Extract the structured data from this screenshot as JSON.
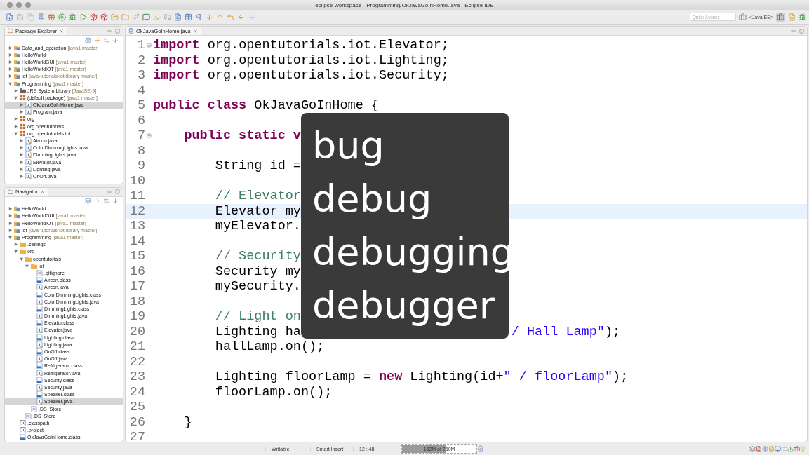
{
  "window": {
    "title": "eclipse-workspace - Programming/OkJavaGoInHome.java - Eclipse IDE"
  },
  "toolbar": {
    "quick_access": {
      "placeholder": "Quick Access"
    },
    "perspective": "<Java EE>"
  },
  "package_explorer": {
    "tab": "Package Explorer",
    "items": [
      {
        "kind": "project",
        "label": "Data_and_operation",
        "decoration": "[java1 master]",
        "expanded": false,
        "selected": false
      },
      {
        "kind": "project",
        "label": "HelloWorld",
        "expanded": false,
        "selected": false
      },
      {
        "kind": "project",
        "label": "HelloWorldGUI",
        "decoration": "[java1 master]",
        "expanded": false,
        "selected": false
      },
      {
        "kind": "project",
        "label": "HelloWorldIOT",
        "decoration": "[java1 master]",
        "expanded": false,
        "selected": false
      },
      {
        "kind": "project",
        "label": "iot",
        "decoration": "[java-tutorials-iot-library master]",
        "expanded": false,
        "selected": false
      },
      {
        "kind": "project",
        "label": "Programming",
        "decoration": "[java1 master]",
        "expanded": true,
        "selected": false,
        "children": [
          {
            "kind": "library",
            "label": "JRE System Library",
            "decoration": "[JavaSE-9]",
            "expanded": false,
            "selected": false
          },
          {
            "kind": "package",
            "label": "(default package)",
            "decoration": "[java1 master]",
            "expanded": true,
            "selected": false,
            "children": [
              {
                "kind": "java",
                "label": "OkJavaGoInHome.java",
                "expanded": false,
                "selected": true
              },
              {
                "kind": "java",
                "label": "Program.java",
                "expanded": false,
                "selected": false
              }
            ]
          },
          {
            "kind": "package",
            "label": "org",
            "expanded": false,
            "selected": false
          },
          {
            "kind": "package",
            "label": "org.opentutorials",
            "expanded": false,
            "selected": false
          },
          {
            "kind": "package",
            "label": "org.opentutorials.iot",
            "expanded": true,
            "selected": false,
            "children": [
              {
                "kind": "java",
                "label": "Aircon.java",
                "expanded": false,
                "selected": false
              },
              {
                "kind": "java",
                "label": "ColorDimmingLights.java",
                "expanded": false,
                "selected": false
              },
              {
                "kind": "java",
                "label": "DimmingLights.java",
                "expanded": false,
                "selected": false
              },
              {
                "kind": "java",
                "label": "Elevator.java",
                "expanded": false,
                "selected": false
              },
              {
                "kind": "java",
                "label": "Lighting.java",
                "expanded": false,
                "selected": false
              },
              {
                "kind": "java",
                "label": "OnOff.java",
                "expanded": false,
                "selected": false
              }
            ]
          }
        ]
      }
    ]
  },
  "navigator": {
    "tab": "Navigator",
    "items": [
      {
        "kind": "project",
        "label": "HelloWorld",
        "expanded": false,
        "selected": false
      },
      {
        "kind": "project",
        "label": "HelloWorldGUI",
        "decoration": "[java1 master]",
        "expanded": false,
        "selected": false
      },
      {
        "kind": "project",
        "label": "HelloWorldIOT",
        "decoration": "[java1 master]",
        "expanded": false,
        "selected": false
      },
      {
        "kind": "project",
        "label": "iot",
        "decoration": "[java-tutorials-iot-library master]",
        "expanded": false,
        "selected": false
      },
      {
        "kind": "project",
        "label": "Programming",
        "decoration": "[java1 master]",
        "expanded": true,
        "selected": false,
        "children": [
          {
            "kind": "folder",
            "label": ".settings",
            "expanded": false,
            "selected": false
          },
          {
            "kind": "folder",
            "label": "org",
            "expanded": true,
            "selected": false,
            "children": [
              {
                "kind": "folder",
                "label": "opentutorials",
                "expanded": true,
                "selected": false,
                "children": [
                  {
                    "kind": "folder",
                    "label": "iot",
                    "expanded": true,
                    "selected": false,
                    "children": [
                      {
                        "kind": "file",
                        "label": ".gitignore",
                        "selected": false
                      },
                      {
                        "kind": "class",
                        "label": "Aircon.class",
                        "selected": false
                      },
                      {
                        "kind": "java",
                        "label": "Aircon.java",
                        "selected": false
                      },
                      {
                        "kind": "class",
                        "label": "ColorDimmingLights.class",
                        "selected": false
                      },
                      {
                        "kind": "java",
                        "label": "ColorDimmingLights.java",
                        "selected": false
                      },
                      {
                        "kind": "class",
                        "label": "DimmingLights.class",
                        "selected": false
                      },
                      {
                        "kind": "java",
                        "label": "DimmingLights.java",
                        "selected": false
                      },
                      {
                        "kind": "class",
                        "label": "Elevator.class",
                        "selected": false
                      },
                      {
                        "kind": "java",
                        "label": "Elevator.java",
                        "selected": false
                      },
                      {
                        "kind": "class",
                        "label": "Lighting.class",
                        "selected": false
                      },
                      {
                        "kind": "java",
                        "label": "Lighting.java",
                        "selected": false
                      },
                      {
                        "kind": "class",
                        "label": "OnOff.class",
                        "selected": false
                      },
                      {
                        "kind": "java",
                        "label": "OnOff.java",
                        "selected": false
                      },
                      {
                        "kind": "class",
                        "label": "Refrigerator.class",
                        "selected": false
                      },
                      {
                        "kind": "java",
                        "label": "Refrigerator.java",
                        "selected": false
                      },
                      {
                        "kind": "class",
                        "label": "Security.class",
                        "selected": false
                      },
                      {
                        "kind": "java",
                        "label": "Security.java",
                        "selected": false
                      },
                      {
                        "kind": "class",
                        "label": "Speaker.class",
                        "selected": false
                      },
                      {
                        "kind": "java",
                        "label": "Speaker.java",
                        "selected": true
                      }
                    ]
                  },
                  {
                    "kind": "file",
                    "label": ".DS_Store",
                    "selected": false
                  }
                ]
              },
              {
                "kind": "file",
                "label": ".DS_Store",
                "selected": false
              }
            ]
          },
          {
            "kind": "xml",
            "label": ".classpath",
            "selected": false
          },
          {
            "kind": "xml",
            "label": ".project",
            "selected": false
          },
          {
            "kind": "class",
            "label": "OkJavaGoInHome.class",
            "selected": false
          }
        ]
      }
    ]
  },
  "editor": {
    "tab": "OkJavaGoInHome.java",
    "lines": [
      {
        "number": "1",
        "fold": true,
        "current": false,
        "code": [
          {
            "kind": "keyword",
            "text": "import"
          },
          {
            "kind": "plain",
            "text": " org.opentutorials.iot.Elevator;"
          }
        ]
      },
      {
        "number": "2",
        "fold": false,
        "current": false,
        "code": [
          {
            "kind": "keyword",
            "text": "import"
          },
          {
            "kind": "plain",
            "text": " org.opentutorials.iot.Lighting;"
          }
        ]
      },
      {
        "number": "3",
        "fold": false,
        "current": false,
        "code": [
          {
            "kind": "keyword",
            "text": "import"
          },
          {
            "kind": "plain",
            "text": " org.opentutorials.iot.Security;"
          }
        ]
      },
      {
        "number": "4",
        "fold": false,
        "current": false
      },
      {
        "number": "5",
        "fold": false,
        "current": false,
        "code": [
          {
            "kind": "keyword",
            "text": "public class"
          },
          {
            "kind": "plain",
            "text": " OkJavaGoInHome {"
          }
        ]
      },
      {
        "number": "6",
        "fold": false,
        "current": false
      },
      {
        "number": "7",
        "fold": true,
        "current": false,
        "code": [
          {
            "kind": "keyword",
            "text": "    public static v"
          }
        ]
      },
      {
        "number": "8",
        "fold": false,
        "current": false
      },
      {
        "number": "9",
        "fold": false,
        "current": false,
        "code": [
          {
            "kind": "plain",
            "text": "        String id ="
          }
        ]
      },
      {
        "number": "10",
        "fold": false,
        "current": false
      },
      {
        "number": "11",
        "fold": false,
        "current": false,
        "code": [
          {
            "kind": "comment",
            "text": "        // Elevator"
          }
        ]
      },
      {
        "number": "12",
        "fold": false,
        "current": true,
        "code": [
          {
            "kind": "plain",
            "text": "        Elevator my"
          }
        ]
      },
      {
        "number": "13",
        "fold": false,
        "current": false,
        "code": [
          {
            "kind": "plain",
            "text": "        myElevator."
          }
        ]
      },
      {
        "number": "14",
        "fold": false,
        "current": false
      },
      {
        "number": "15",
        "fold": false,
        "current": false,
        "code": [
          {
            "kind": "comment",
            "text": "        // Security"
          }
        ]
      },
      {
        "number": "16",
        "fold": false,
        "current": false,
        "code": [
          {
            "kind": "plain",
            "text": "        Security my"
          }
        ]
      },
      {
        "number": "17",
        "fold": false,
        "current": false,
        "code": [
          {
            "kind": "plain",
            "text": "        mySecurity."
          }
        ]
      },
      {
        "number": "18",
        "fold": false,
        "current": false
      },
      {
        "number": "19",
        "fold": false,
        "current": false,
        "code": [
          {
            "kind": "comment",
            "text": "        // Light on"
          }
        ]
      },
      {
        "number": "20",
        "fold": false,
        "current": false,
        "code": [
          {
            "kind": "plain",
            "text": "        Lighting ha"
          }
        ],
        "code_right": [
          {
            "kind": "string",
            "text": "/ Hall Lamp\""
          },
          {
            "kind": "plain",
            "text": ");"
          }
        ]
      },
      {
        "number": "21",
        "fold": false,
        "current": false,
        "code": [
          {
            "kind": "plain",
            "text": "        hallLamp.on();"
          }
        ]
      },
      {
        "number": "22",
        "fold": false,
        "current": false
      },
      {
        "number": "23",
        "fold": false,
        "current": false,
        "code": [
          {
            "kind": "plain",
            "text": "        Lighting floorLamp = "
          },
          {
            "kind": "keyword",
            "text": "new"
          },
          {
            "kind": "plain",
            "text": " Lighting(id+"
          },
          {
            "kind": "string",
            "text": "\" / floorLamp\""
          },
          {
            "kind": "plain",
            "text": ");"
          }
        ]
      },
      {
        "number": "24",
        "fold": false,
        "current": false,
        "code": [
          {
            "kind": "plain",
            "text": "        floorLamp.on();"
          }
        ]
      },
      {
        "number": "25",
        "fold": false,
        "current": false
      },
      {
        "number": "26",
        "fold": false,
        "current": false,
        "code": [
          {
            "kind": "plain",
            "text": "    }"
          }
        ]
      },
      {
        "number": "27",
        "fold": false,
        "current": false
      }
    ]
  },
  "overlay": {
    "words": [
      "bug",
      "debug",
      "debugging",
      "debugger"
    ]
  },
  "status_bar": {
    "mode": "Writable",
    "insert": "Smart Insert",
    "position": "12 : 48",
    "heap": {
      "text": "152M of 260M",
      "level": 0.585
    }
  }
}
